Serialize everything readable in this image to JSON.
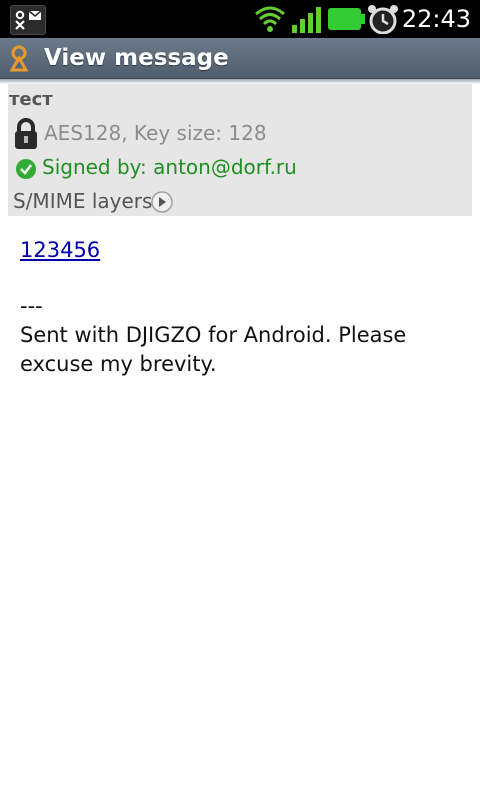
{
  "status_bar": {
    "time": "22:43",
    "icons": [
      "notification-icon",
      "wifi-icon",
      "signal-icon",
      "battery-icon",
      "alarm-icon"
    ],
    "battery_color": "#33cc33",
    "signal_color": "#66cc33"
  },
  "title_bar": {
    "title": "View message",
    "icon": "app-icon",
    "background": "#5a6878"
  },
  "header": {
    "subject": "тест",
    "encryption": "AES128, Key size: 128",
    "signed_by": "Signed by: anton@dorf.ru",
    "signed_color": "#1f8f1f",
    "smime_layers": "S/MIME layers"
  },
  "body": {
    "link": "123456",
    "separator": "---",
    "signature_line1": "Sent with DJIGZO for Android. Please",
    "signature_line2": "excuse my brevity."
  }
}
